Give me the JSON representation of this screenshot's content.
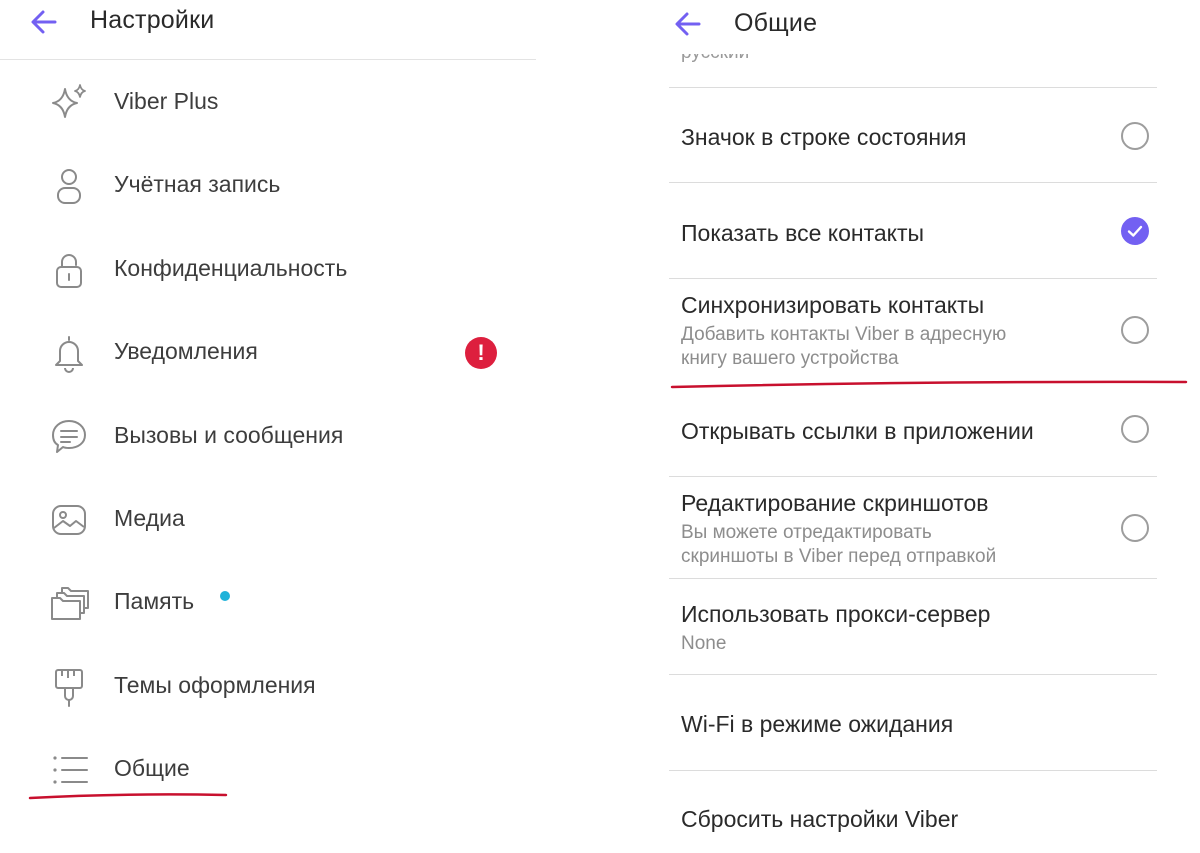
{
  "colors": {
    "accent": "#7360f2",
    "badge_error": "#dd1f3e",
    "badge_dot": "#1fb2d9",
    "annotation": "#c8102e"
  },
  "left": {
    "title": "Настройки",
    "items": [
      {
        "label": "Viber Plus",
        "icon": "sparkle-icon"
      },
      {
        "label": "Учётная запись",
        "icon": "account-icon"
      },
      {
        "label": "Конфиденциальность",
        "icon": "lock-icon"
      },
      {
        "label": "Уведомления",
        "icon": "bell-icon",
        "badge": "!"
      },
      {
        "label": "Вызовы и сообщения",
        "icon": "chat-icon"
      },
      {
        "label": "Медиа",
        "icon": "media-icon"
      },
      {
        "label": "Память",
        "icon": "folders-icon",
        "dot": true
      },
      {
        "label": "Темы оформления",
        "icon": "brush-icon"
      },
      {
        "label": "Общие",
        "icon": "list-icon"
      }
    ]
  },
  "right": {
    "title": "Общие",
    "partial_text": "русский",
    "settings": [
      {
        "title": "Значок в строке состояния",
        "checked": false
      },
      {
        "title": "Показать все контакты",
        "checked": true
      },
      {
        "title": "Синхронизировать контакты",
        "subtitle_1": "Добавить контакты Viber в адресную",
        "subtitle_2": "книгу вашего устройства",
        "checked": false
      },
      {
        "title": "Открывать ссылки в приложении",
        "checked": false
      },
      {
        "title": "Редактирование скриншотов",
        "subtitle_1": "Вы можете отредактировать",
        "subtitle_2": "скриншоты в Viber перед отправкой",
        "checked": false
      },
      {
        "title": "Использовать прокси-сервер",
        "subtitle_1": "None"
      },
      {
        "title": "Wi-Fi в режиме ожидания"
      },
      {
        "title": "Сбросить настройки Viber"
      }
    ]
  }
}
